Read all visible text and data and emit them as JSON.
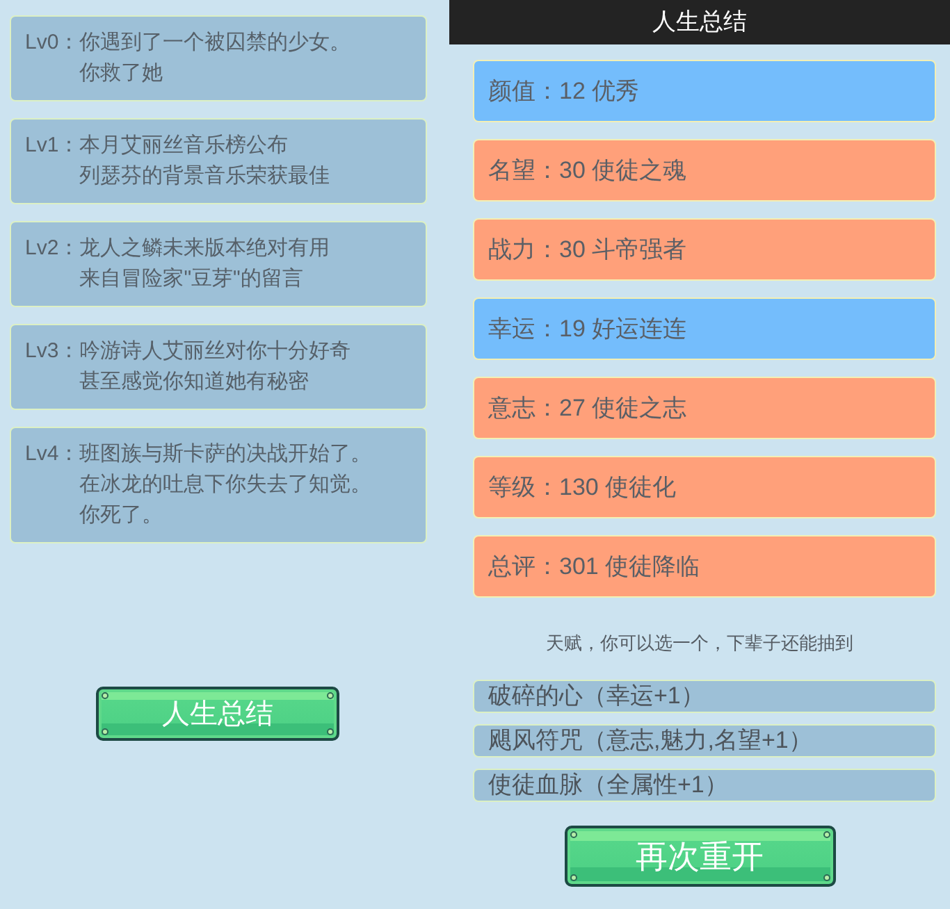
{
  "events": [
    {
      "label": "Lv0：",
      "lines": [
        "你遇到了一个被囚禁的少女。",
        "你救了她"
      ]
    },
    {
      "label": "Lv1：",
      "lines": [
        "本月艾丽丝音乐榜公布",
        "列瑟芬的背景音乐荣获最佳"
      ]
    },
    {
      "label": "Lv2：",
      "lines": [
        "龙人之鳞未来版本绝对有用",
        "来自冒险家\"豆芽\"的留言"
      ]
    },
    {
      "label": "Lv3：",
      "lines": [
        "吟游诗人艾丽丝对你十分好奇",
        "甚至感觉你知道她有秘密"
      ]
    },
    {
      "label": "Lv4：",
      "lines": [
        "班图族与斯卡萨的决战开始了。",
        "在冰龙的吐息下你失去了知觉。",
        "你死了。"
      ]
    }
  ],
  "summary_button": "人生总结",
  "panel": {
    "title": "人生总结"
  },
  "stats": [
    {
      "text": "颜值：12 优秀",
      "color": "#74bdfc"
    },
    {
      "text": "名望：30 使徒之魂",
      "color": "#ffa07a"
    },
    {
      "text": "战力：30 斗帝强者",
      "color": "#ffa07a"
    },
    {
      "text": "幸运：19 好运连连",
      "color": "#74bdfc"
    },
    {
      "text": "意志：27 使徒之志",
      "color": "#ffa07a"
    },
    {
      "text": "等级：130 使徒化",
      "color": "#ffa07a"
    },
    {
      "text": "总评：301 使徒降临",
      "color": "#ffa07a"
    }
  ],
  "talents_hint": "天赋，你可以选一个，下辈子还能抽到",
  "talents": [
    {
      "text": "破碎的心（幸运+1）",
      "selected": false
    },
    {
      "text": "飓风符咒（意志,魅力,名望+1）",
      "selected": false
    },
    {
      "text": "使徒血脉（全属性+1）",
      "selected": false
    }
  ],
  "restart_button": "再次重开"
}
